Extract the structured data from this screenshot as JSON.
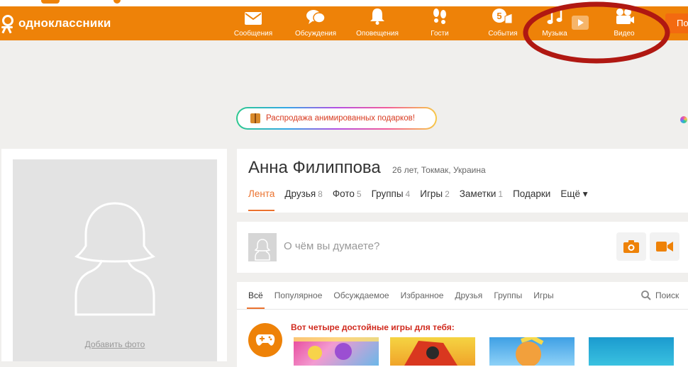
{
  "header": {
    "logo_text": "одноклассники",
    "nav": [
      {
        "label": "Сообщения",
        "icon": "envelope-icon"
      },
      {
        "label": "Обсуждения",
        "icon": "chat-bubbles-icon"
      },
      {
        "label": "Оповещения",
        "icon": "bell-icon"
      },
      {
        "label": "Гости",
        "icon": "footprints-icon"
      },
      {
        "label": "События",
        "icon": "events-hand-icon"
      },
      {
        "label": "Музыка",
        "icon": "music-note-icon"
      },
      {
        "label": "Видео",
        "icon": "video-camera-icon"
      }
    ],
    "search_label": "Поиск"
  },
  "promo": {
    "text": "Распродажа анимированных подарков!"
  },
  "left_card": {
    "add_photo": "Добавить фото"
  },
  "profile": {
    "name": "Анна Филиппова",
    "meta": "26 лет, Токмак, Украина",
    "tabs": [
      {
        "label": "Лента",
        "count": ""
      },
      {
        "label": "Друзья",
        "count": "8"
      },
      {
        "label": "Фото",
        "count": "5"
      },
      {
        "label": "Группы",
        "count": "4"
      },
      {
        "label": "Игры",
        "count": "2"
      },
      {
        "label": "Заметки",
        "count": "1"
      },
      {
        "label": "Подарки",
        "count": ""
      },
      {
        "label": "Ещё ▾",
        "count": ""
      }
    ]
  },
  "composer": {
    "placeholder": "О чём вы думаете?"
  },
  "feed": {
    "tabs": [
      "Всё",
      "Популярное",
      "Обсуждаемое",
      "Избранное",
      "Друзья",
      "Группы",
      "Игры"
    ],
    "search_label": "Поиск",
    "games_title": "Вот четыре достойные игры для тебя:"
  },
  "colors": {
    "brand_orange": "#ee8208",
    "annotation_red": "#b01812",
    "promo_text": "#d83a20",
    "active_tab": "#eb722e"
  }
}
